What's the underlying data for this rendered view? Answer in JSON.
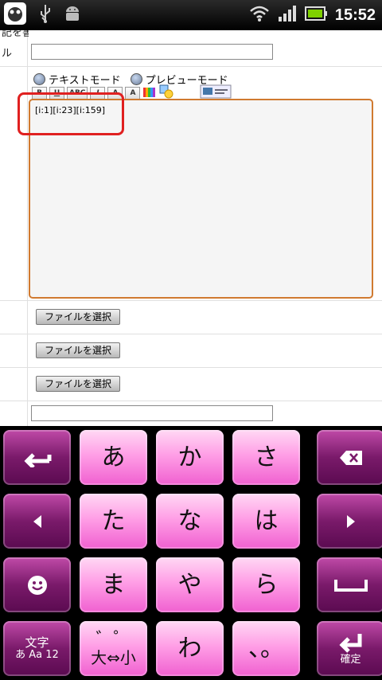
{
  "status_bar": {
    "time": "15:52"
  },
  "page": {
    "fragment_top": "記を書く",
    "label_title": "ル",
    "mode_text": "テキストモード",
    "mode_preview": "プレビューモード",
    "toolbar": {
      "bold": "B",
      "underline": "U",
      "strike": "ABC",
      "italic": "I",
      "size": "A",
      "font": "A"
    },
    "editor_text": "[i:1][i:23][i:159]",
    "file_button": "ファイルを選択"
  },
  "keyboard": {
    "rows": [
      [
        "あ",
        "か",
        "さ"
      ],
      [
        "た",
        "な",
        "は"
      ],
      [
        "ま",
        "や",
        "ら"
      ],
      [
        "",
        "わ",
        "、。"
      ]
    ],
    "dakuten_top": "゛゜",
    "dakuten_bottom": "大⇔小",
    "mode_key_top": "文字",
    "mode_key_bottom": "あ Aa 12",
    "enter_label": "確定"
  },
  "colors": {
    "key_pink": "#ff9fe6",
    "key_dark": "#7a1a6a",
    "highlight": "#e02020",
    "editor_border": "#d07a30"
  }
}
